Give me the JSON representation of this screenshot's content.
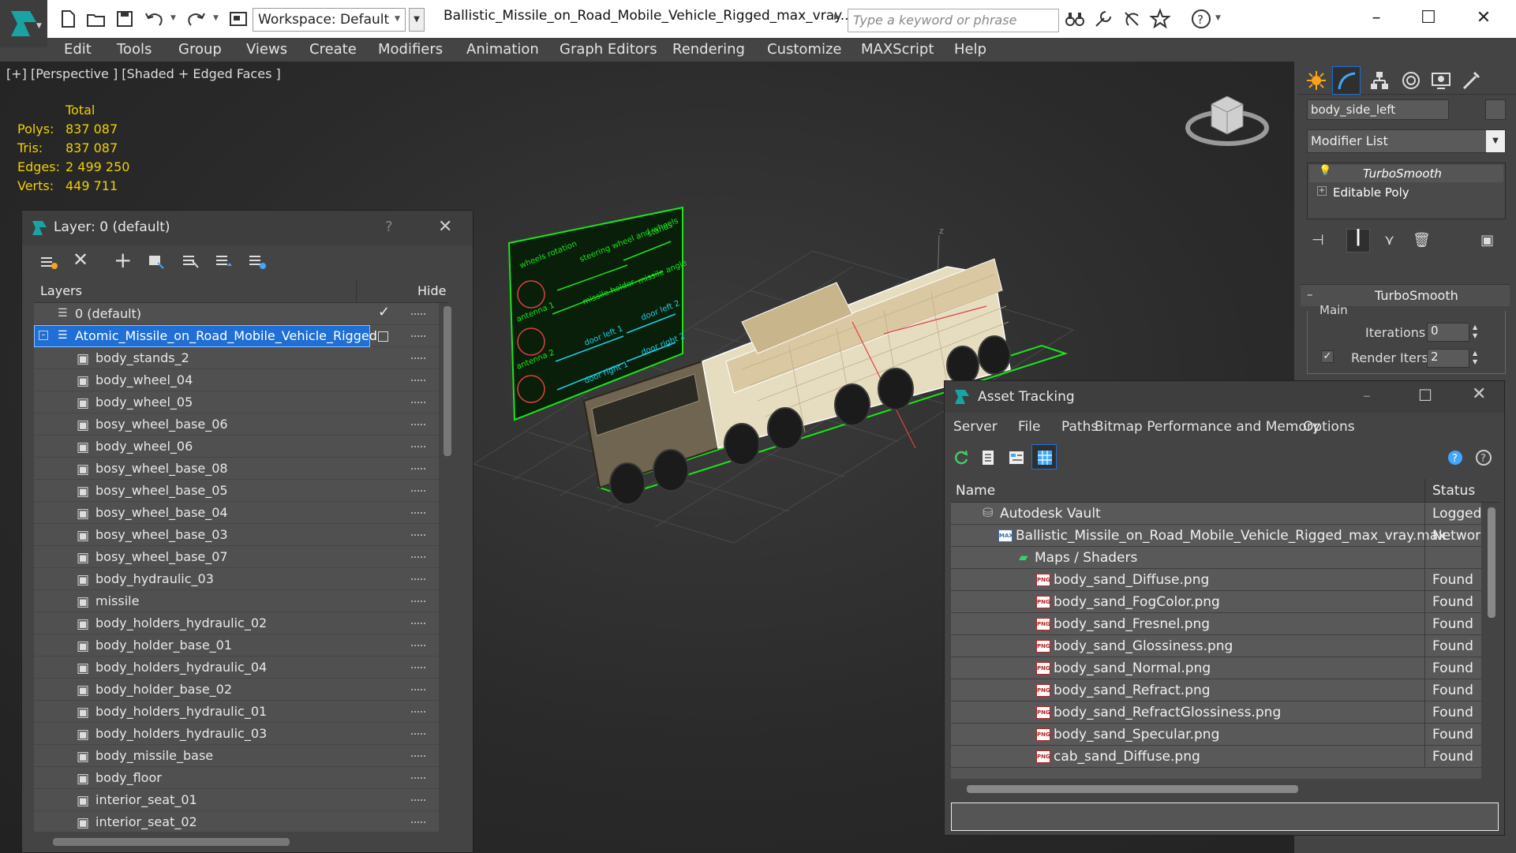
{
  "titlebar": {
    "workspace": "Workspace: Default",
    "document_title": "Ballistic_Missile_on_Road_Mobile_Vehicle_Rigged_max_vray....",
    "search_placeholder": "Type a keyword or phrase"
  },
  "menu": [
    "Edit",
    "Tools",
    "Group",
    "Views",
    "Create",
    "Modifiers",
    "Animation",
    "Graph Editors",
    "Rendering",
    "Customize",
    "MAXScript",
    "Help"
  ],
  "viewport": {
    "label": "[+] [Perspective ] [Shaded + Edged Faces ]",
    "stats": {
      "header": "Total",
      "rows": [
        {
          "label": "Polys:",
          "value": "837 087"
        },
        {
          "label": "Tris:",
          "value": "837 087"
        },
        {
          "label": "Edges:",
          "value": "2 499 250"
        },
        {
          "label": "Verts:",
          "value": "449 711"
        }
      ]
    },
    "rig_panel": {
      "left_labels": [
        "wheels rotation",
        "antenna 1",
        "antenna 2"
      ],
      "mid_labels": [
        "steering wheel and wheels",
        "missile holder",
        "door left 1",
        "door right 1"
      ],
      "right_labels": [
        "stands",
        "missile angle",
        "door left 2",
        "door right 2"
      ]
    },
    "axis_z": "z"
  },
  "command_panel": {
    "object_name": "body_side_left",
    "modifier_list": "Modifier List",
    "stack": [
      "TurboSmooth",
      "Editable Poly"
    ],
    "rollout_title": "TurboSmooth",
    "group_label": "Main",
    "iterations_label": "Iterations:",
    "iterations_value": "0",
    "render_iters_label": "Render Iters:",
    "render_iters_value": "2",
    "render_iters_checked": true
  },
  "layer_window": {
    "title": "Layer: 0 (default)",
    "help": "?",
    "col_layers": "Layers",
    "col_hide": "Hide",
    "default_layer": "0 (default)",
    "selected_layer": "Atomic_Missile_on_Road_Mobile_Vehicle_Rigged",
    "objects": [
      "body_stands_2",
      "body_wheel_04",
      "body_wheel_05",
      "bosy_wheel_base_06",
      "body_wheel_06",
      "bosy_wheel_base_08",
      "bosy_wheel_base_05",
      "bosy_wheel_base_04",
      "bosy_wheel_base_03",
      "bosy_wheel_base_07",
      "body_hydraulic_03",
      "missile",
      "body_holders_hydraulic_02",
      "body_holder_base_01",
      "body_holders_hydraulic_04",
      "body_holder_base_02",
      "body_holders_hydraulic_01",
      "body_holders_hydraulic_03",
      "body_missile_base",
      "body_floor",
      "interior_seat_01",
      "interior_seat_02"
    ]
  },
  "asset_window": {
    "title": "Asset Tracking",
    "menu": [
      "Server",
      "File",
      "Paths",
      "Bitmap Performance and Memory",
      "Options"
    ],
    "col_name": "Name",
    "col_status": "Status",
    "vault": {
      "name": "Autodesk Vault",
      "status": "Logged"
    },
    "max_file": {
      "name": "Ballistic_Missile_on_Road_Mobile_Vehicle_Rigged_max_vray.max",
      "status": "Network"
    },
    "maps_folder": "Maps / Shaders",
    "maps": [
      {
        "name": "body_sand_Diffuse.png",
        "status": "Found"
      },
      {
        "name": "body_sand_FogColor.png",
        "status": "Found"
      },
      {
        "name": "body_sand_Fresnel.png",
        "status": "Found"
      },
      {
        "name": "body_sand_Glossiness.png",
        "status": "Found"
      },
      {
        "name": "body_sand_Normal.png",
        "status": "Found"
      },
      {
        "name": "body_sand_Refract.png",
        "status": "Found"
      },
      {
        "name": "body_sand_RefractGlossiness.png",
        "status": "Found"
      },
      {
        "name": "body_sand_Specular.png",
        "status": "Found"
      },
      {
        "name": "cab_sand_Diffuse.png",
        "status": "Found"
      }
    ],
    "png_tag": "PNG",
    "max_tag": "MAX"
  },
  "colors": {
    "selection": "#1f6fd6",
    "stats_yellow": "#f0d000",
    "rig_green": "#19e619",
    "rig_cyan": "#19d0e6",
    "vehicle_sand": "#d9c8a2",
    "ground_grid": "#4a4a4a"
  }
}
